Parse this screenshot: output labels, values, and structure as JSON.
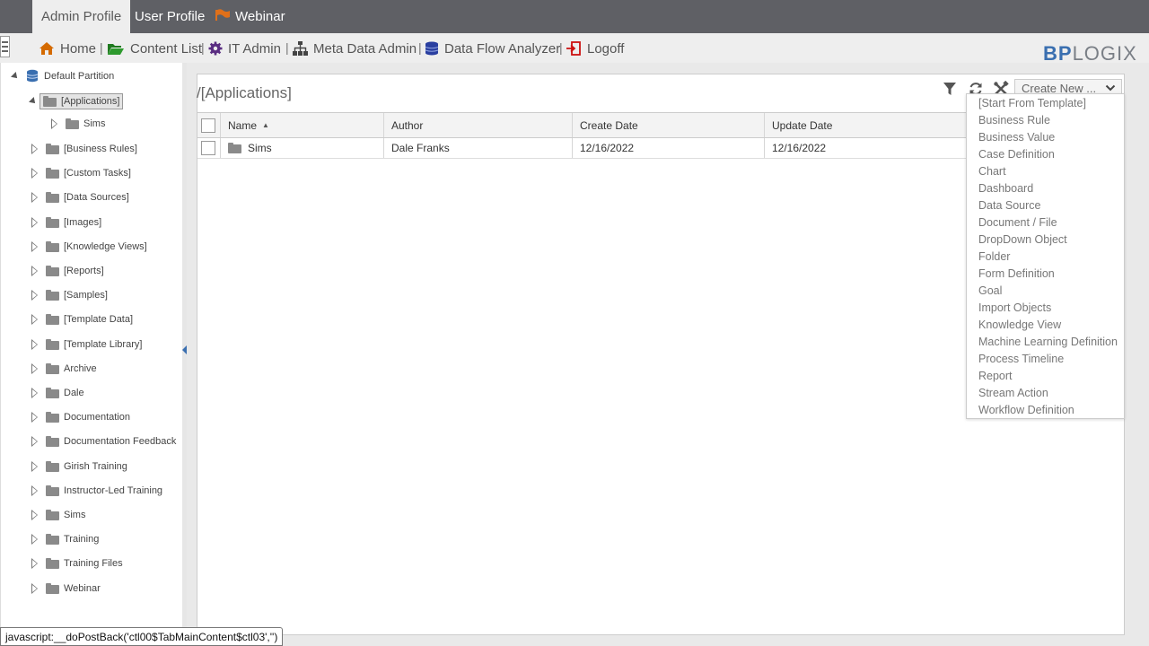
{
  "top_tabs": {
    "admin_profile": "Admin Profile",
    "user_profile": "User Profile",
    "webinar": "Webinar"
  },
  "nav": {
    "home": "Home",
    "content_list": "Content List",
    "it_admin": "IT Admin",
    "meta_data_admin": "Meta Data Admin",
    "data_flow_analyzer": "Data Flow Analyzer",
    "logoff": "Logoff",
    "separator": "|"
  },
  "logo": {
    "bp": "BP",
    "logix": "LOGIX"
  },
  "tree": {
    "root": "Default Partition",
    "selected": "[Applications]",
    "selected_child": "Sims",
    "items": [
      "[Business Rules]",
      "[Custom Tasks]",
      "[Data Sources]",
      "[Images]",
      "[Knowledge Views]",
      "[Reports]",
      "[Samples]",
      "[Template Data]",
      "[Template Library]",
      "Archive",
      "Dale",
      "Documentation",
      "Documentation Feedback",
      "Girish Training",
      "Instructor-Led Training",
      "Sims",
      "Training",
      "Training Files",
      "Webinar"
    ]
  },
  "main": {
    "path": "/[Applications]",
    "create_new": "Create New ...",
    "columns": [
      "Name",
      "Author",
      "Create Date",
      "Update Date"
    ],
    "rows": [
      {
        "name": "Sims",
        "author": "Dale Franks",
        "create_date": "12/16/2022",
        "update_date": "12/16/2022"
      }
    ]
  },
  "create_menu": [
    "[Start From Template]",
    "Business Rule",
    "Business Value",
    "Case Definition",
    "Chart",
    "Dashboard",
    "Data Source",
    "Document / File",
    "DropDown Object",
    "Folder",
    "Form Definition",
    "Goal",
    "Import Objects",
    "Knowledge View",
    "Machine Learning Definition",
    "Process Timeline",
    "Report",
    "Stream Action",
    "Workflow Definition"
  ],
  "status_bar": "javascript:__doPostBack('ctl00$TabMainContent$ctl03','')",
  "colors": {
    "topbar": "#5f6065",
    "navbar": "#eeeeee",
    "logo_blue": "#3a6fb0",
    "home_icon": "#d46a00",
    "folder_icon": "#2e8b2e",
    "gear_icon": "#5a2d82",
    "data_flow_icon": "#2a3fa0",
    "logoff_icon": "#cc1111"
  }
}
